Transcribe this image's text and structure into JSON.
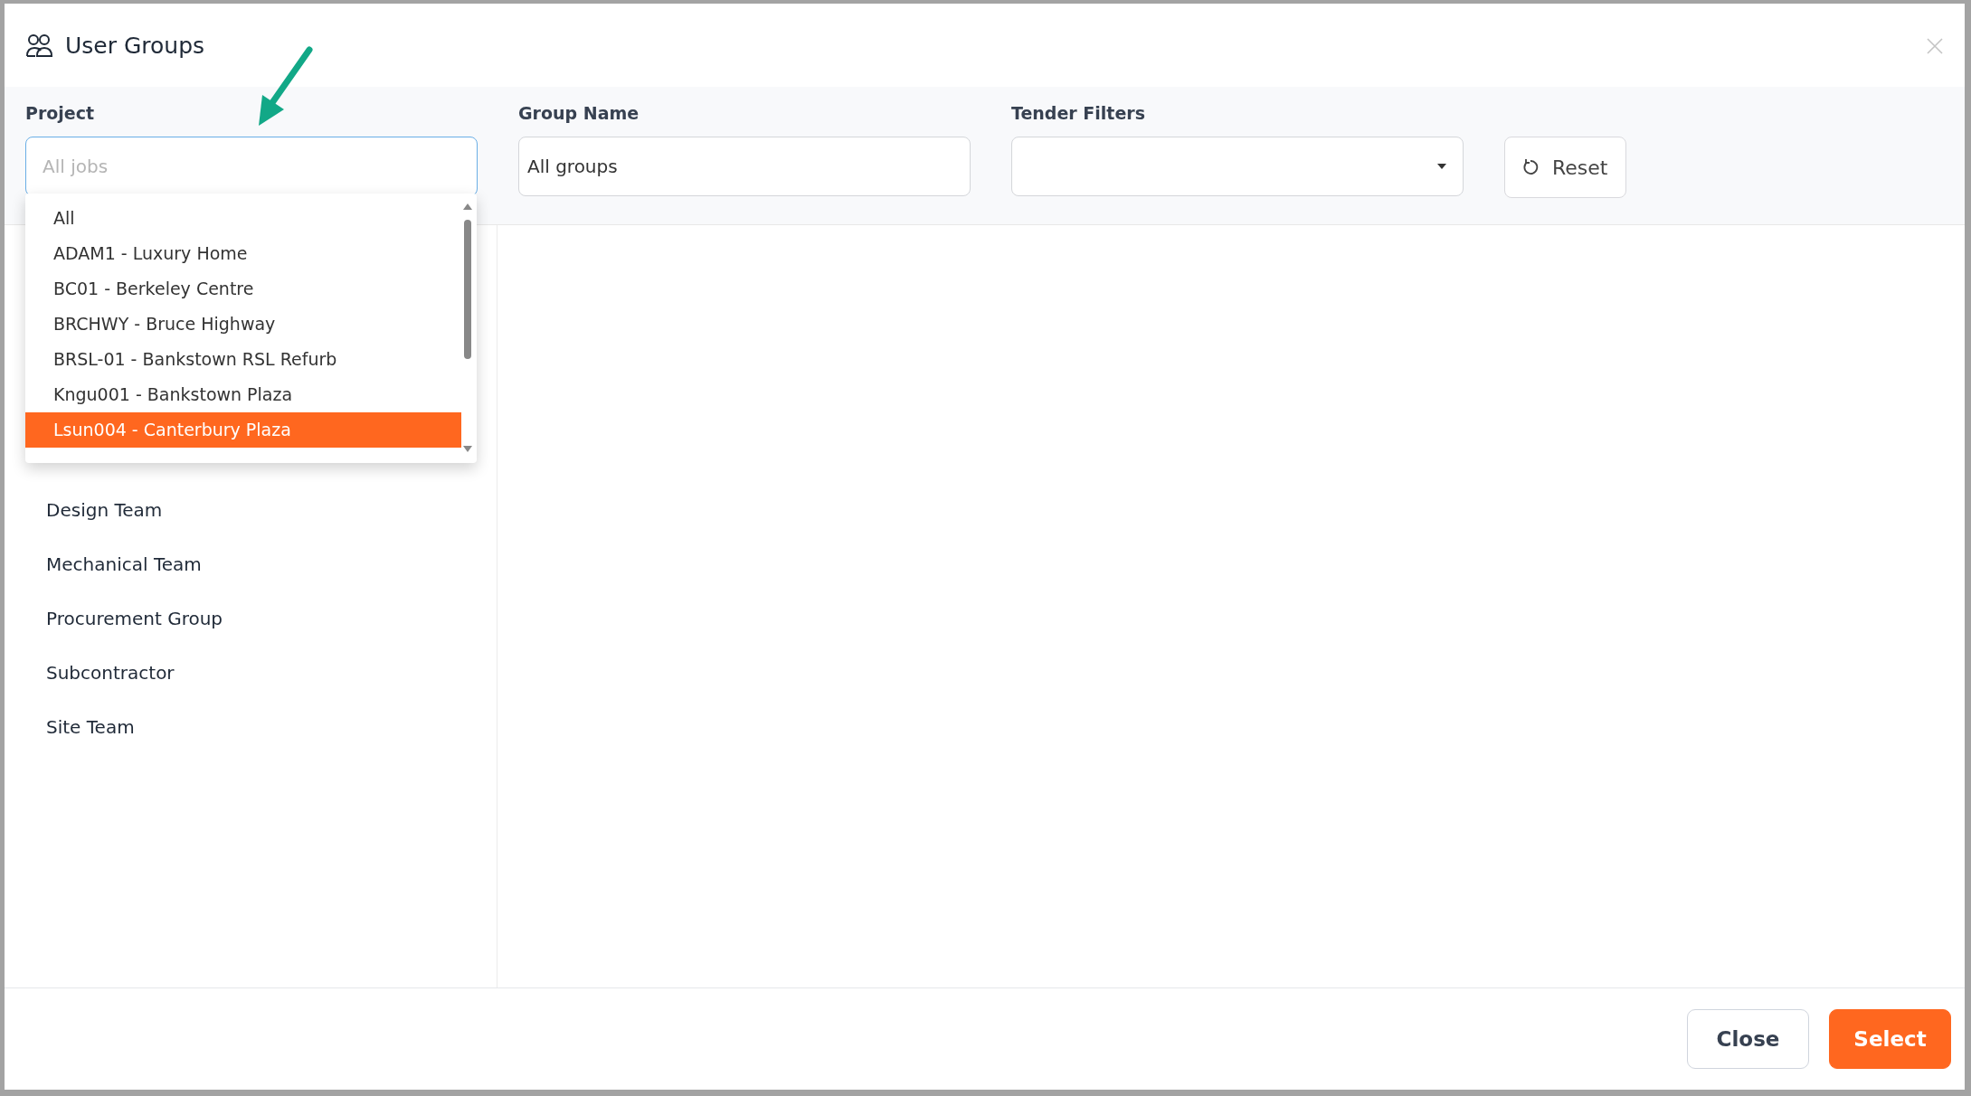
{
  "window": {
    "title": "User Groups"
  },
  "filters": [
    {
      "kind": "input",
      "label": "Project",
      "placeholder": "All jobs",
      "focused": true
    },
    {
      "kind": "input",
      "label": "Group Name",
      "value": "All groups",
      "focused": false
    },
    {
      "kind": "select",
      "label": "Tender Filters",
      "focused": false
    }
  ],
  "reset_button": "Reset",
  "project_dropdown": {
    "items": [
      {
        "label": "All",
        "selected": false
      },
      {
        "label": "ADAM1 - Luxury Home",
        "selected": false
      },
      {
        "label": "BC01 - Berkeley Centre",
        "selected": false
      },
      {
        "label": "BRCHWY - Bruce Highway",
        "selected": false
      },
      {
        "label": "BRSL-01 - Bankstown RSL Refurb",
        "selected": false
      },
      {
        "label": "Kngu001 - Bankstown Plaza",
        "selected": false
      },
      {
        "label": "Lsun004 - Canterbury Plaza",
        "selected": true
      }
    ]
  },
  "groups": [
    {
      "label": "Design Team"
    },
    {
      "label": "Mechanical Team"
    },
    {
      "label": "Procurement Group"
    },
    {
      "label": "Subcontractor"
    },
    {
      "label": "Site Team"
    }
  ],
  "buttons": [
    {
      "kind": "secondary",
      "label": "Close"
    },
    {
      "kind": "primary",
      "label": "Select"
    }
  ]
}
